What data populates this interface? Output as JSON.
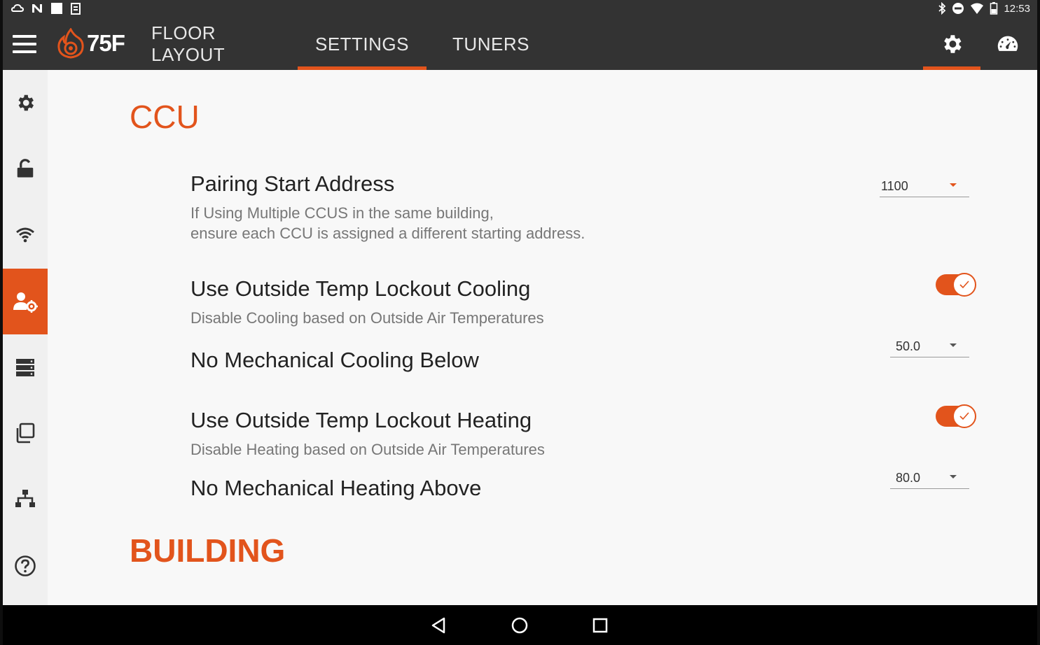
{
  "status_bar": {
    "time": "12:53",
    "left_icons": [
      "cloud-icon",
      "n-icon",
      "square-icon",
      "clipboard-icon"
    ],
    "right_icons": [
      "bluetooth-icon",
      "do-not-disturb-icon",
      "wifi-icon",
      "battery-icon"
    ]
  },
  "app_bar": {
    "logo_text": "75F",
    "tabs": [
      {
        "label": "FLOOR LAYOUT",
        "active": false
      },
      {
        "label": "SETTINGS",
        "active": true
      },
      {
        "label": "TUNERS",
        "active": false
      }
    ],
    "right_icons": [
      "gear-icon",
      "dashboard-icon"
    ],
    "accent_color": "#e2541c"
  },
  "side_rail": {
    "items": [
      {
        "icon": "gear-icon",
        "active": false
      },
      {
        "icon": "unlock-icon",
        "active": false
      },
      {
        "icon": "wifi-icon",
        "active": false
      },
      {
        "icon": "user-settings-icon",
        "active": true
      },
      {
        "icon": "server-icon",
        "active": false
      },
      {
        "icon": "copy-icon",
        "active": false
      },
      {
        "icon": "hierarchy-icon",
        "active": false
      },
      {
        "icon": "help-icon",
        "active": false
      }
    ]
  },
  "content": {
    "ccu_title": "CCU",
    "pairing": {
      "title": "Pairing Start Address",
      "subtitle_line1": "If Using Multiple CCUS in the same building,",
      "subtitle_line2": "ensure each CCU is assigned a different starting address.",
      "value": "1100"
    },
    "cooling_lockout": {
      "title": "Use Outside Temp Lockout Cooling",
      "subtitle": "Disable Cooling based on Outside Air Temperatures",
      "enabled": true
    },
    "cooling_below": {
      "title": "No Mechanical Cooling Below",
      "value": "50.0"
    },
    "heating_lockout": {
      "title": "Use Outside Temp Lockout Heating",
      "subtitle": "Disable Heating based on Outside Air Temperatures",
      "enabled": true
    },
    "heating_above": {
      "title": "No Mechanical Heating Above",
      "value": "80.0"
    },
    "building_title": "BUILDING"
  },
  "nav_bar": {
    "buttons": [
      "back-icon",
      "home-icon",
      "recents-icon"
    ]
  }
}
